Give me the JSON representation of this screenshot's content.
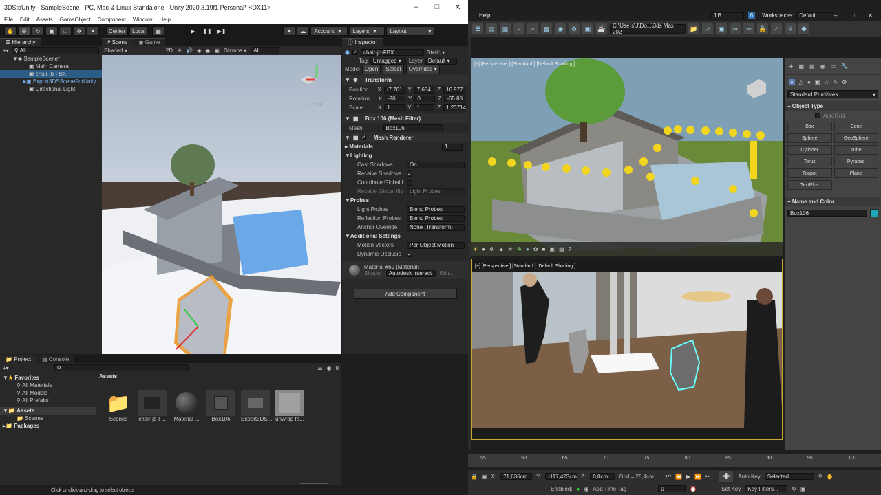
{
  "unity": {
    "title": "3DStoUnity - SampleScene - PC, Mac & Linux Standalone - Unity 2020.3.19f1 Personal* <DX11>",
    "menu": [
      "File",
      "Edit",
      "Assets",
      "GameObject",
      "Component",
      "Window",
      "Help"
    ],
    "toolbar": {
      "center": "Center",
      "local": "Local",
      "account": "Account",
      "layers": "Layers",
      "layout": "Layout"
    },
    "hierarchy": {
      "tab": "Hierarchy",
      "search": "All",
      "items": [
        {
          "label": "SampleScene*",
          "indent": 0
        },
        {
          "label": "Main Camera",
          "indent": 1
        },
        {
          "label": "chair-jb-FBX",
          "indent": 1,
          "selected": true
        },
        {
          "label": "Export3DSSceneForUnity",
          "indent": 1,
          "prefab": true
        },
        {
          "label": "Directional Light",
          "indent": 1
        }
      ]
    },
    "scene": {
      "tab_scene": "Scene",
      "tab_game": "Game",
      "shading": "Shaded",
      "mode2d": "2D",
      "gizmos": "Gizmos",
      "search": "All",
      "persp": "Persp"
    },
    "inspector": {
      "tab": "Inspector",
      "object_name": "chair-jb-FBX",
      "static": "Static",
      "tag_label": "Tag",
      "tag": "Untagged",
      "layer_label": "Layer",
      "layer": "Default",
      "model_label": "Model",
      "open": "Open",
      "select": "Select",
      "overrides": "Overrides",
      "transform": {
        "title": "Transform",
        "position": {
          "label": "Position",
          "x": "-7.761",
          "y": "7.654",
          "z": "16.977"
        },
        "rotation": {
          "label": "Rotation",
          "x": "-90",
          "y": "0",
          "z": "-65.88"
        },
        "scale": {
          "label": "Scale",
          "x": "1",
          "y": "1",
          "z": "1.23714"
        }
      },
      "mesh_filter": {
        "title": "Box 106 (Mesh Filter)",
        "mesh_label": "Mesh",
        "mesh": "Box106"
      },
      "mesh_renderer": {
        "title": "Mesh Renderer",
        "materials_label": "Materials",
        "materials_count": "1",
        "lighting": "Lighting",
        "cast_shadows_label": "Cast Shadows",
        "cast_shadows": "On",
        "receive_shadows_label": "Receive Shadows",
        "contribute_gi_label": "Contribute Global I",
        "receive_gi_label": "Receive Global Illu",
        "receive_gi": "Light Probes",
        "probes": "Probes",
        "light_probes_label": "Light Probes",
        "light_probes": "Blend Probes",
        "reflection_probes_label": "Reflection Probes",
        "reflection_probes": "Blend Probes",
        "anchor_label": "Anchor Override",
        "anchor": "None (Transform)",
        "additional": "Additional Settings",
        "motion_label": "Motion Vectors",
        "motion": "Per Object Motion",
        "dynamic_label": "Dynamic Occlusio"
      },
      "material": {
        "title": "Material #69 (Material)",
        "shader_label": "Shader",
        "shader": "Autodesk Interact",
        "edit": "Edit..."
      },
      "add_component": "Add Component"
    },
    "project": {
      "tab_project": "Project",
      "tab_console": "Console",
      "count": "9",
      "tree": [
        {
          "label": "Favorites",
          "indent": 0,
          "bold": true
        },
        {
          "label": "All Materials",
          "indent": 1
        },
        {
          "label": "All Models",
          "indent": 1
        },
        {
          "label": "All Prefabs",
          "indent": 1
        },
        {
          "label": "Assets",
          "indent": 0,
          "bold": true,
          "selected": true
        },
        {
          "label": "Scenes",
          "indent": 1
        },
        {
          "label": "Packages",
          "indent": 0,
          "bold": true
        }
      ],
      "breadcrumb": "Assets",
      "assets": [
        "Scenes",
        "chair-jb-F...",
        "Material ...",
        "Box106",
        "Export3DS...",
        "unwrap fa..."
      ]
    },
    "status": "Click or click-and-drag to select objects"
  },
  "max": {
    "help": "Help",
    "user": "J B",
    "badge": "6",
    "workspaces_label": "Workspaces:",
    "workspace": "Default",
    "path": "C:\\Users\\J\\Do...\\3ds Max 202",
    "vp1": "[+] [Perspective ] [Standard ] [Default Shading ]",
    "vp2": "[+] [Perspective ] [Standard ] [Default Shading ]",
    "primitives": "Standard Primitives",
    "object_type": "Object Type",
    "autogrid": "AutoGrid",
    "buttons": [
      "Box",
      "Cone",
      "Sphere",
      "GeoSphere",
      "Cylinder",
      "Tube",
      "Torus",
      "Pyramid",
      "Teapot",
      "Plane",
      "TextPlus"
    ],
    "name_color": "Name and Color",
    "name": "Box106",
    "color": "#1fa8b8",
    "timeline": [
      "55",
      "60",
      "65",
      "70",
      "75",
      "80",
      "85",
      "90",
      "95",
      "100"
    ],
    "x_label": "X:",
    "x": "71,636cm",
    "y_label": "Y:",
    "y": "-117,423cm",
    "z_label": "Z:",
    "z": "0,0cm",
    "grid": "Grid = 25,4cm",
    "enabled": "Enabled:",
    "add_time_tag": "Add Time Tag",
    "auto_key": "Auto Key",
    "selected": "Selected",
    "set_key": "Set Key",
    "key_filters": "Key Filters...",
    "frame": "0"
  }
}
